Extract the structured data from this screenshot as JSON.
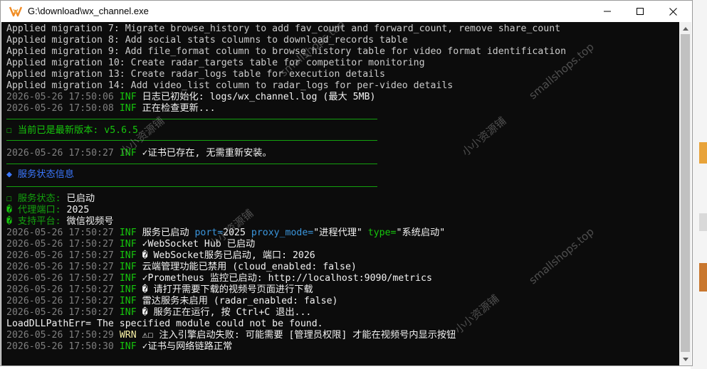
{
  "window": {
    "title": "G:\\download\\wx_channel.exe",
    "minimize_glyph": "—",
    "maximize_glyph": "☐",
    "close_glyph": "✕"
  },
  "colors": {
    "console_bg": "#0c0c0c",
    "timestamp": "#7f7f7f",
    "info_level": "#16c60c",
    "warn_level": "#f9f1a5",
    "text": "#cccccc"
  },
  "console": {
    "migrations": [
      "Applied migration 7: Migrate browse_history to add fav_count and forward_count, remove share_count",
      "Applied migration 8: Add social stats columns to download_records table",
      "Applied migration 9: Add file_format column to browse_history table for video format identification",
      "Applied migration 10: Create radar_targets table for competitor monitoring",
      "Applied migration 13: Create radar_logs table for execution details",
      "Applied migration 14: Add video_list column to radar_logs for per-video details"
    ],
    "log1": {
      "ts": "2026-05-26 17:50:06",
      "level": "INF",
      "msg": " 日志已初始化: logs/wx_channel.log (最大 5MB)"
    },
    "log2": {
      "ts": "2026-05-26 17:50:08",
      "level": "INF",
      "msg": " 正在检查更新..."
    },
    "version_line": "☐ 当前已是最新版本: v5.6.5",
    "log3": {
      "ts": "2026-05-26 17:50:27",
      "level": "INF",
      "msg": " ✓证书已存在, 无需重新安装。"
    },
    "service_header": "◆ 服务状态信息",
    "status": [
      {
        "icon": "☐",
        "key": " 服务状态: ",
        "value": "已启动"
      },
      {
        "icon": "�",
        "key": " 代理端口: ",
        "value": "2025"
      },
      {
        "icon": "�",
        "key": " 支持平台: ",
        "value": "微信视频号"
      }
    ],
    "log4": {
      "ts": "2026-05-26 17:50:27",
      "level": "INF",
      "msg": " 服务已启动 ",
      "k1": "port=",
      "v1": "2025",
      "k2": " proxy_mode=",
      "v2": "\"进程代理\"",
      "k3": " type=",
      "v3": "\"系统启动\""
    },
    "log5": {
      "ts": "2026-05-26 17:50:27",
      "level": "INF",
      "msg": " ✓WebSocket Hub 已启动"
    },
    "log6": {
      "ts": "2026-05-26 17:50:27",
      "level": "INF",
      "msg": " � WebSocket服务已启动, 端口: 2026"
    },
    "log7": {
      "ts": "2026-05-26 17:50:27",
      "level": "INF",
      "msg": " 云端管理功能已禁用 (cloud_enabled: false)"
    },
    "log8": {
      "ts": "2026-05-26 17:50:27",
      "level": "INF",
      "msg": " ✓Prometheus 监控已启动: http://localhost:9090/metrics"
    },
    "log9": {
      "ts": "2026-05-26 17:50:27",
      "level": "INF",
      "msg": " � 请打开需要下载的视频号页面进行下载"
    },
    "log10": {
      "ts": "2026-05-26 17:50:27",
      "level": "INF",
      "msg": " 雷达服务未启用 (radar_enabled: false)"
    },
    "log11": {
      "ts": "2026-05-26 17:50:27",
      "level": "INF",
      "msg": " � 服务正在运行, 按 Ctrl+C 退出..."
    },
    "dll_error": "LoadDLLPathErr= The specified module could not be found.",
    "log12": {
      "ts": "2026-05-26 17:50:29",
      "level": "WRN",
      "msg": " ⚠☐ 注入引擎启动失败: 可能需要 [管理员权限] 才能在视频号内显示按钮"
    },
    "log13": {
      "ts": "2026-05-26 17:50:30",
      "level": "INF",
      "msg": " ✓证书与网络链路正常"
    }
  },
  "watermarks": [
    "smallshops.top",
    "小小资源铺",
    "smallshops.top",
    "小小资源铺",
    "小小资源铺",
    "smallshops.top",
    "小小资源铺"
  ]
}
